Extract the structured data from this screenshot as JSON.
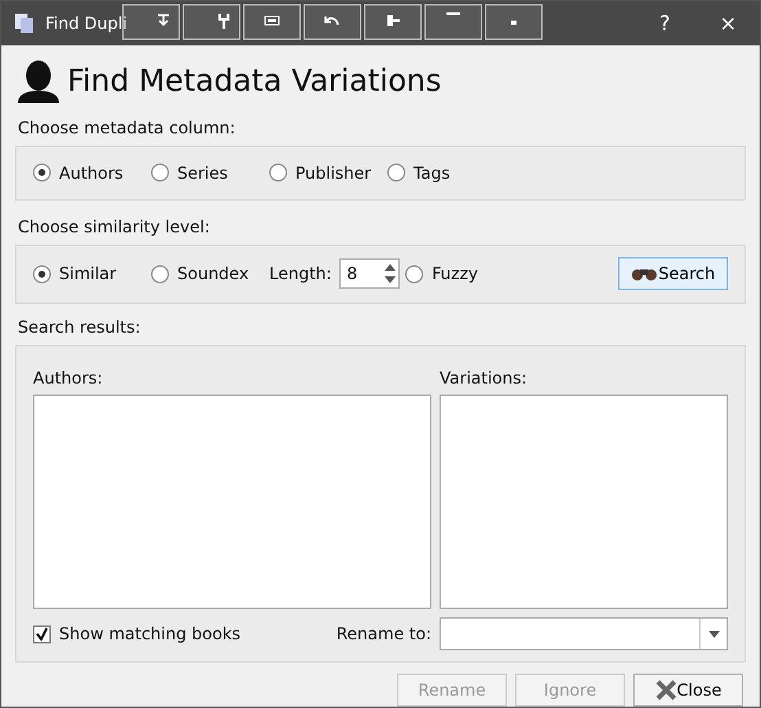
{
  "window": {
    "title": "Find Dupli",
    "buttons": [
      "?",
      "×"
    ]
  },
  "heading": "Find Metadata Variations",
  "column_group": {
    "label": "Choose metadata column:",
    "options": [
      {
        "label": "Authors",
        "selected": true
      },
      {
        "label": "Series",
        "selected": false
      },
      {
        "label": "Publisher",
        "selected": false
      },
      {
        "label": "Tags",
        "selected": false
      }
    ]
  },
  "similarity_group": {
    "label": "Choose similarity level:",
    "options": [
      {
        "label": "Similar",
        "selected": true
      },
      {
        "label": "Soundex",
        "selected": false
      },
      {
        "label": "Fuzzy",
        "selected": false
      }
    ],
    "length_label": "Length:",
    "length_value": "8",
    "search_button": "Search"
  },
  "results": {
    "label": "Search results:",
    "authors_label": "Authors:",
    "variations_label": "Variations:",
    "show_matching": {
      "label": "Show matching books",
      "checked": true
    },
    "rename_label": "Rename to:"
  },
  "buttons": [
    {
      "label": "Rename",
      "disabled": true,
      "kind": "text"
    },
    {
      "label": "Ignore",
      "disabled": true,
      "kind": "text"
    },
    {
      "label": "Close",
      "disabled": false,
      "kind": "close"
    }
  ]
}
